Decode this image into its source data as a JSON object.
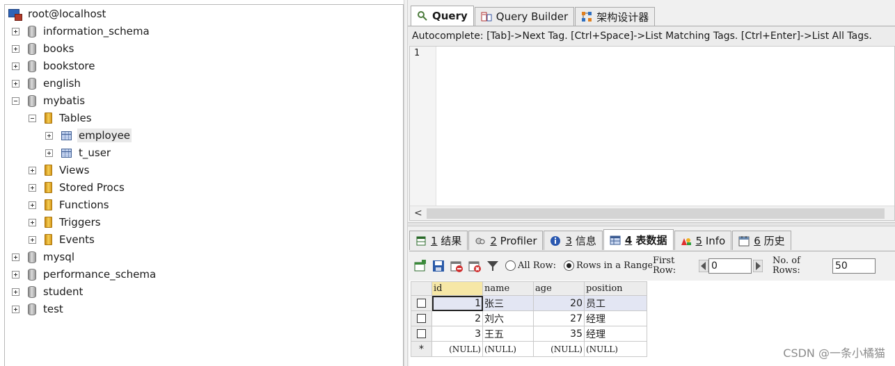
{
  "tree": {
    "root": "root@localhost",
    "databases": [
      {
        "label": "information_schema"
      },
      {
        "label": "books"
      },
      {
        "label": "bookstore"
      },
      {
        "label": "english"
      },
      {
        "label": "mybatis"
      },
      {
        "label": "mysql"
      },
      {
        "label": "performance_schema"
      },
      {
        "label": "student"
      },
      {
        "label": "test"
      }
    ],
    "mybatis_children": {
      "tables": "Tables",
      "table_items": [
        "employee",
        "t_user"
      ],
      "views": "Views",
      "stored_procs": "Stored Procs",
      "functions": "Functions",
      "triggers": "Triggers",
      "events": "Events"
    }
  },
  "top_tabs": {
    "query": "Query",
    "query_builder": "Query Builder",
    "schema_designer": "架构设计器"
  },
  "autocomplete_hint": "Autocomplete: [Tab]->Next Tag. [Ctrl+Space]->List Matching Tags. [Ctrl+Enter]->List All Tags.",
  "editor": {
    "line_number": "1",
    "scroll_left_arrow": "<"
  },
  "result_tabs": [
    {
      "num": "1",
      "label": "结果"
    },
    {
      "num": "2",
      "label": "Profiler"
    },
    {
      "num": "3",
      "label": "信息"
    },
    {
      "num": "4",
      "label": "表数据"
    },
    {
      "num": "5",
      "label": "Info"
    },
    {
      "num": "6",
      "label": "历史"
    }
  ],
  "toolbar": {
    "all_rows": "All Row:",
    "rows_in_range": "Rows in a Range",
    "first_row_label_1": "First",
    "first_row_label_2": "Row:",
    "first_row_value": "0",
    "no_rows_label_1": "No. of",
    "no_rows_label_2": "Rows:",
    "no_rows_value": "50"
  },
  "grid": {
    "columns": [
      "id",
      "name",
      "age",
      "position"
    ],
    "rows": [
      [
        "1",
        "张三",
        "20",
        "员工"
      ],
      [
        "2",
        "刘六",
        "27",
        "经理"
      ],
      [
        "3",
        "王五",
        "35",
        "经理"
      ]
    ],
    "new_row_marker": "*",
    "null_text": "(NULL)"
  },
  "watermark": "CSDN @一条小橘猫",
  "colors": {
    "header_highlight": "#f6e7a6",
    "selected_row": "#e3e6f3",
    "panel_bg": "#f0f0f0"
  }
}
